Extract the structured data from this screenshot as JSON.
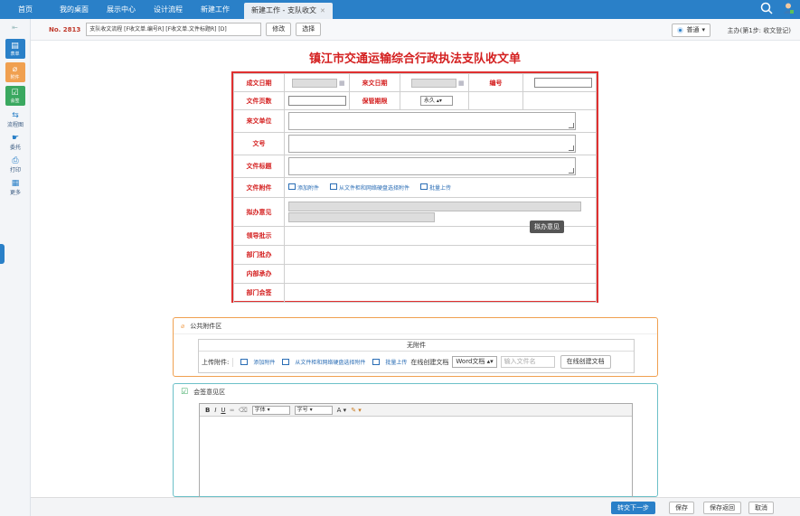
{
  "nav": {
    "tabs": [
      "首页",
      "我的桌面",
      "展示中心",
      "设计流程",
      "新建工作"
    ],
    "active_tab": "新建工作 - 支队收文"
  },
  "sidebar": {
    "buttons": [
      {
        "label": "表单",
        "color": "#2a80c8",
        "icon": "form-icon"
      },
      {
        "label": "附件",
        "color": "#f0a050",
        "icon": "paperclip-icon"
      },
      {
        "label": "会签",
        "color": "#3aa860",
        "icon": "check-icon"
      }
    ],
    "items": [
      {
        "label": "流程图",
        "icon": "flowchart-icon"
      },
      {
        "label": "委托",
        "icon": "delegate-icon"
      },
      {
        "label": "打印",
        "icon": "print-icon"
      },
      {
        "label": "更多",
        "icon": "grid-icon"
      }
    ]
  },
  "toolbar": {
    "no": "No. 2813",
    "flow_name": "支队收文流程 [F收文单.编号R] [F收文单.文件标题R] [D]",
    "edit": "修改",
    "choose": "选择",
    "mode": "普通",
    "step": "主办(第1步: 收文登记)"
  },
  "form": {
    "title": "镇江市交通运输综合行政执法支队收文单",
    "labels": {
      "date_done": "成文日期",
      "date_in": "来文日期",
      "number": "编号",
      "pages": "文件页数",
      "retention": "保管期限",
      "retention_value": "永久",
      "unit": "来文单位",
      "doc_no": "文号",
      "doc_title": "文件标题",
      "attachment": "文件附件",
      "opinion": "拟办意见",
      "leader": "领导批示",
      "dept_handle": "部门批办",
      "internal": "内部承办",
      "dept_sign": "部门会签"
    },
    "attach_add": "添加附件",
    "attach_net": "从文件柜和网络硬盘选择附件",
    "attach_batch": "批量上传",
    "tooltip": "拟办意见"
  },
  "public": {
    "title": "公共附件区",
    "none": "无附件",
    "upload_label": "上传附件:",
    "add": "添加附件",
    "net": "从文件柜和网络硬盘选择附件",
    "batch": "批量上传",
    "online_create": "在线创建文档",
    "doc_type": "Word文档",
    "filename_placeholder": "输入文件名",
    "create_btn": "在线创建文档"
  },
  "sign": {
    "title": "会签意见区",
    "font": "字体",
    "size": "字号"
  },
  "footer": {
    "next": "转交下一步",
    "save": "保存",
    "save_back": "保存返回",
    "cancel": "取消"
  },
  "colors": {
    "accent": "#2a80c8",
    "form_red": "#d42020"
  }
}
